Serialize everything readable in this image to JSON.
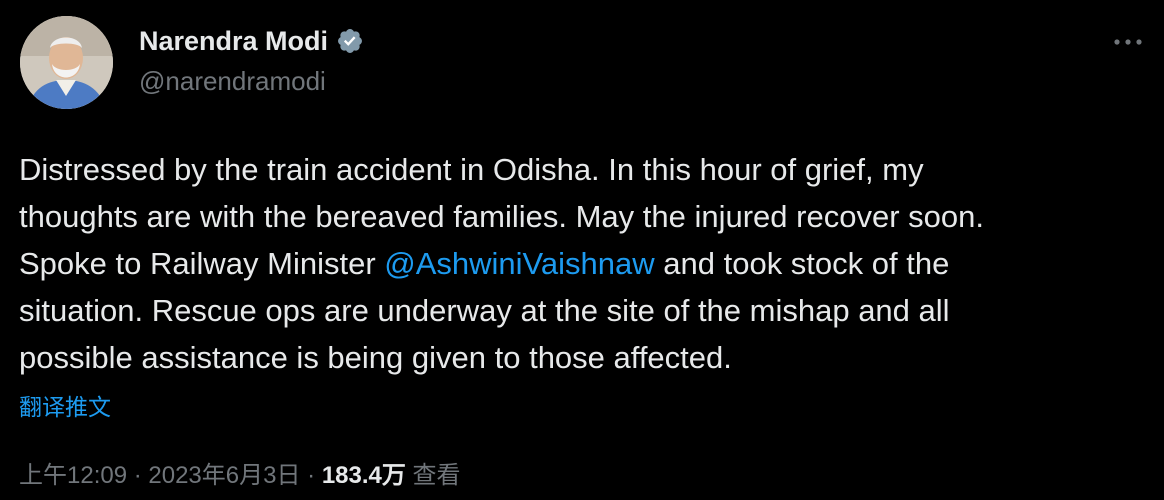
{
  "author": {
    "display_name": "Narendra Modi",
    "handle": "@narendramodi",
    "verified": true
  },
  "tweet": {
    "text_line_1": "Distressed by the train accident in Odisha. In this hour of grief, my",
    "text_line_2": "thoughts are with the bereaved families. May the injured recover soon.",
    "text_line_3_before": "Spoke to Railway Minister ",
    "mention": "@AshwiniVaishnaw",
    "text_line_3_after": " and took stock of the",
    "text_line_4": "situation. Rescue ops are underway at the site of the mishap and all",
    "text_line_5": "possible assistance is being given to those affected."
  },
  "translate_label": "翻译推文",
  "meta": {
    "time": "上午12:09",
    "separator": " · ",
    "date": "2023年6月3日",
    "views_count": "183.4万",
    "views_label": " 查看"
  },
  "icons": {
    "verified": "verified-badge-icon",
    "more": "more-options-icon"
  },
  "colors": {
    "background": "#000000",
    "text": "#e7e9ea",
    "secondary": "#71767b",
    "accent": "#1d9bf0"
  }
}
